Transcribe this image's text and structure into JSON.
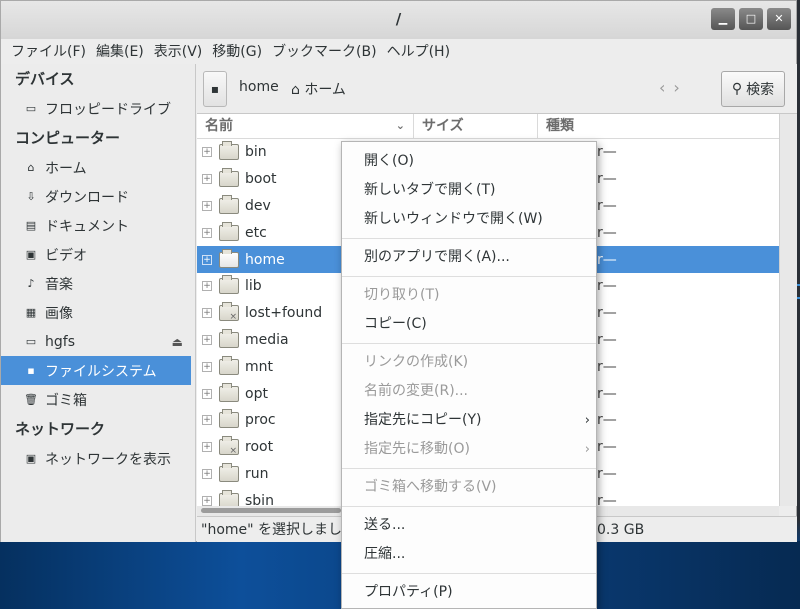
{
  "window": {
    "title": "/",
    "buttons": {
      "minimize": "▁",
      "maximize": "□",
      "close": "✕"
    }
  },
  "menubar": [
    "ファイル(F)",
    "編集(E)",
    "表示(V)",
    "移動(G)",
    "ブックマーク(B)",
    "ヘルプ(H)"
  ],
  "sidebar": {
    "devices_header": "デバイス",
    "devices": [
      {
        "label": "フロッピードライブ",
        "icon": "floppy-icon"
      }
    ],
    "computer_header": "コンピューター",
    "places": [
      {
        "label": "ホーム",
        "icon": "home-folder-icon"
      },
      {
        "label": "ダウンロード",
        "icon": "download-folder-icon"
      },
      {
        "label": "ドキュメント",
        "icon": "documents-folder-icon"
      },
      {
        "label": "ビデオ",
        "icon": "video-folder-icon"
      },
      {
        "label": "音楽",
        "icon": "music-folder-icon"
      },
      {
        "label": "画像",
        "icon": "pictures-folder-icon"
      },
      {
        "label": "hgfs",
        "icon": "folder-icon"
      },
      {
        "label": "ファイルシステム",
        "icon": "drive-icon"
      },
      {
        "label": "ゴミ箱",
        "icon": "trash-icon"
      }
    ],
    "network_header": "ネットワーク",
    "network": [
      {
        "label": "ネットワークを表示",
        "icon": "network-icon"
      }
    ]
  },
  "toolbar": {
    "crumbs": [
      "home",
      "ホーム"
    ],
    "search_label": "検索"
  },
  "filelist": {
    "columns": [
      "名前",
      "サイズ",
      "種類"
    ],
    "rows": [
      {
        "name": "bin"
      },
      {
        "name": "boot"
      },
      {
        "name": "dev"
      },
      {
        "name": "etc"
      },
      {
        "name": "home",
        "selected": true
      },
      {
        "name": "lib"
      },
      {
        "name": "lost+found",
        "locked": true
      },
      {
        "name": "media"
      },
      {
        "name": "mnt"
      },
      {
        "name": "opt"
      },
      {
        "name": "proc"
      },
      {
        "name": "root",
        "locked": true
      },
      {
        "name": "run"
      },
      {
        "name": "sbin"
      }
    ],
    "type_suffix": "r—"
  },
  "status": {
    "left": "\"home\" を選択しまし",
    "right": "0.3 GB"
  },
  "context_menu": [
    {
      "label": "開く(O)",
      "disabled": false
    },
    {
      "label": "新しいタブで開く(T)",
      "disabled": false
    },
    {
      "label": "新しいウィンドウで開く(W)",
      "disabled": false
    },
    {
      "sep": true
    },
    {
      "label": "別のアプリで開く(A)...",
      "disabled": false
    },
    {
      "sep": true
    },
    {
      "label": "切り取り(T)",
      "disabled": true
    },
    {
      "label": "コピー(C)",
      "disabled": false
    },
    {
      "sep": true
    },
    {
      "label": "リンクの作成(K)",
      "disabled": true
    },
    {
      "label": "名前の変更(R)...",
      "disabled": true
    },
    {
      "label": "指定先にコピー(Y)",
      "disabled": false,
      "submenu": true
    },
    {
      "label": "指定先に移動(O)",
      "disabled": true,
      "submenu": true
    },
    {
      "sep": true
    },
    {
      "label": "ゴミ箱へ移動する(V)",
      "disabled": true
    },
    {
      "sep": true
    },
    {
      "label": "送る...",
      "disabled": false
    },
    {
      "label": "圧縮...",
      "disabled": false
    },
    {
      "sep": true
    },
    {
      "label": "プロパティ(P)",
      "disabled": false
    }
  ]
}
